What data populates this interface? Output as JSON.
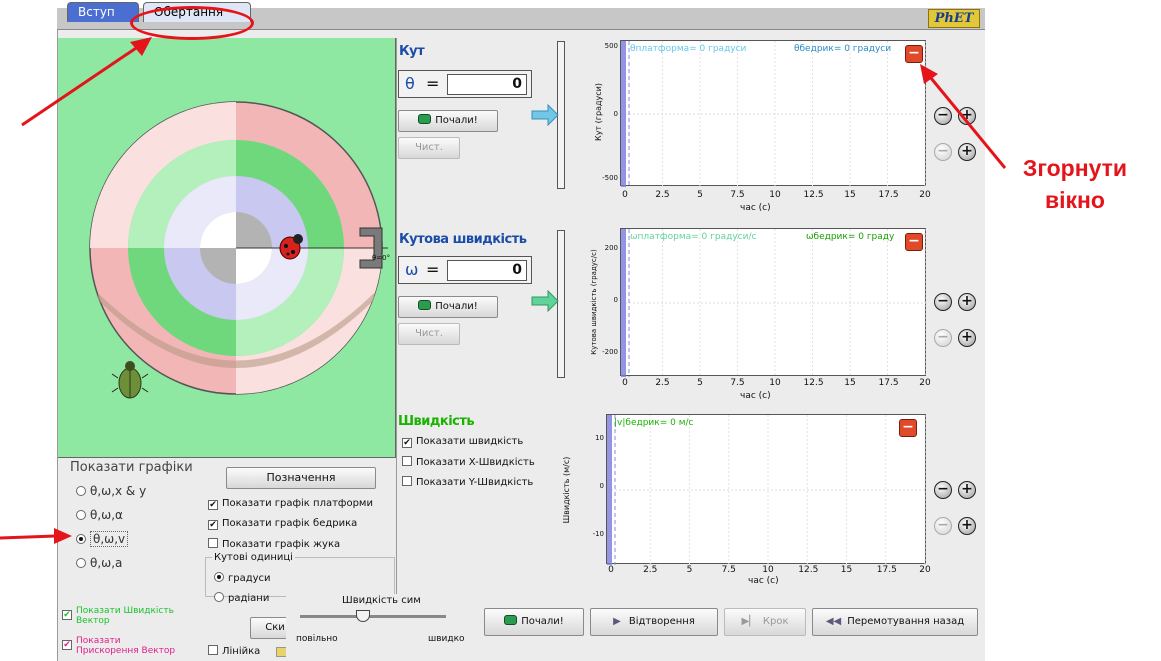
{
  "tabs": [
    "Вступ",
    "Обертання"
  ],
  "brand": "PhET",
  "angle_panel": {
    "title": "Кут",
    "symbol": "θ",
    "value": "0",
    "go": "Почали!",
    "clear": "Чист."
  },
  "angvel_panel": {
    "title": "Кутова швидкість",
    "symbol": "ω",
    "value": "0",
    "go": "Почали!",
    "clear": "Чист."
  },
  "velocity_panel": {
    "title": "Швидкість",
    "show_velocity": "Показати швидкість",
    "show_x": "Показати X-Швидкість",
    "show_y": "Показати Y-Швидкість"
  },
  "graph1": {
    "ylabel": "Кут (градуси)",
    "xlabel": "час (с)",
    "yticks": [
      "500",
      "0",
      "-500"
    ],
    "legend_platform": "θплатформа= 0 градуси",
    "legend_hip": "θбедрик= 0 градуси"
  },
  "graph2": {
    "ylabel": "Кутова швидкість (градус/с)",
    "xlabel": "час (с)",
    "yticks": [
      "200",
      "0",
      "-200"
    ],
    "legend_platform": "ωплатформа= 0 градуси/с",
    "legend_hip": "ωбедрик= 0 граду"
  },
  "graph3": {
    "ylabel": "Швидкість (м/с)",
    "xlabel": "час (с)",
    "yticks": [
      "10",
      "0",
      "-10"
    ],
    "legend_hip": "|v|бедрик= 0 м/с"
  },
  "xticks": [
    "0",
    "2.5",
    "5",
    "7.5",
    "10",
    "12.5",
    "15",
    "17.5",
    "20"
  ],
  "graph_options": {
    "title": "Показати графіки",
    "options": [
      "θ,ω,x & y",
      "θ,ω,α",
      "θ,ω,v",
      "θ,ω,a"
    ],
    "selected": 2,
    "labels_button": "Позначення",
    "show_platform": "Показати графік платформи",
    "show_hip": "Показати графік бедрика",
    "show_bug": "Показати графік жука",
    "units_title": "Кутові одиниці",
    "degrees": "градуси",
    "radians": "радіани"
  },
  "vectors": {
    "velocity": "Показати Швидкість Вектор",
    "acceleration": "Показати Прискорення Вектор",
    "ruler": "Лінійка",
    "reset_partial": "Ски"
  },
  "sim_speed": {
    "title": "Швидкість сим",
    "slow": "повільно",
    "fast": "швидко"
  },
  "controls": {
    "go": "Почали!",
    "playback": "Відтворення",
    "step": "Крок",
    "rewind": "Перемотування назад"
  },
  "platform_angle_marker": "θ=0°",
  "annotation": {
    "line1": "Згорнути",
    "line2": "вікно"
  },
  "colors": {
    "playfield": "#8fe8a1",
    "highlight": "#e5141b",
    "graph_cyan": "#66c8e8",
    "graph_green": "#19b300"
  }
}
